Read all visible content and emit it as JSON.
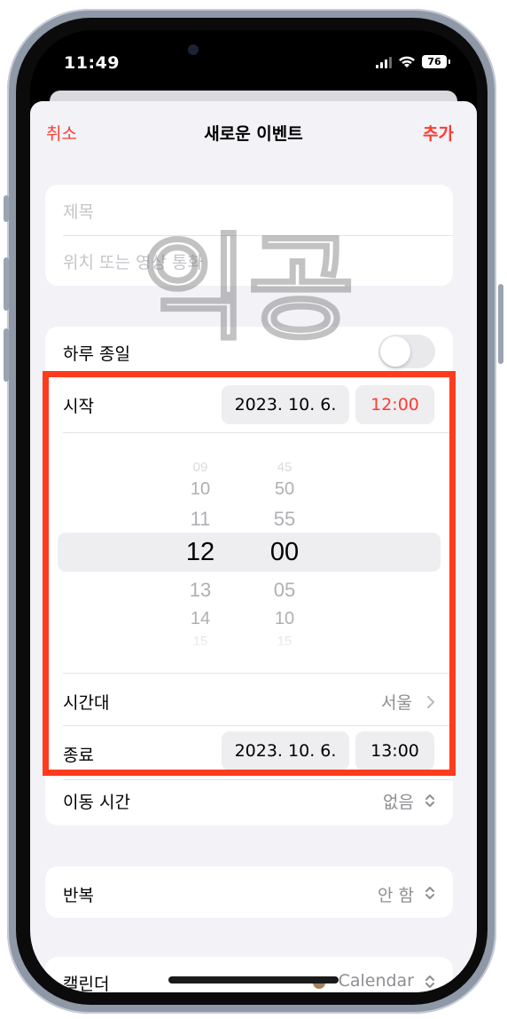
{
  "status": {
    "time": "11:49",
    "battery": "76"
  },
  "nav": {
    "cancel": "취소",
    "title": "새로운 이벤트",
    "add": "추가"
  },
  "form": {
    "title_placeholder": "제목",
    "location_placeholder": "위치 또는 영상 통화"
  },
  "all_day": {
    "label": "하루 종일",
    "on": false
  },
  "start": {
    "label": "시작",
    "date": "2023. 10. 6.",
    "time": "12:00"
  },
  "picker": {
    "hours": [
      "09",
      "10",
      "11",
      "12",
      "13",
      "14",
      "15"
    ],
    "minutes": [
      "45",
      "50",
      "55",
      "00",
      "05",
      "10",
      "15"
    ],
    "selected_hour": "12",
    "selected_minute": "00"
  },
  "timezone": {
    "label": "시간대",
    "value": "서울"
  },
  "end": {
    "label": "종료",
    "date": "2023. 10. 6.",
    "time": "13:00"
  },
  "travel_time": {
    "label": "이동 시간",
    "value": "없음"
  },
  "repeat": {
    "label": "반복",
    "value": "안 함"
  },
  "calendar": {
    "label": "캘린더",
    "value": "Calendar"
  },
  "watermark": "익공",
  "colors": {
    "accent": "#ff3b30",
    "highlight_box": "#ff3b1e",
    "background": "#f2f2f7"
  }
}
